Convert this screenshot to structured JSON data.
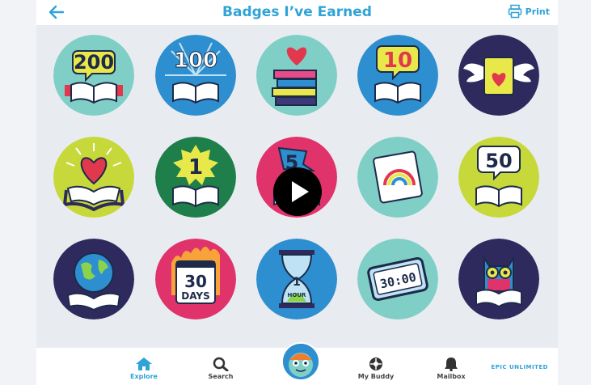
{
  "header": {
    "title": "Badges I’ve Earned",
    "print_label": "Print"
  },
  "badges": [
    {
      "text": "200"
    },
    {
      "text": "100"
    },
    {
      "text": ""
    },
    {
      "text": "10"
    },
    {
      "text": ""
    },
    {
      "text": ""
    },
    {
      "text": "1"
    },
    {
      "text": "5"
    },
    {
      "text": ""
    },
    {
      "text": "50"
    },
    {
      "text": ""
    },
    {
      "text_line1": "30",
      "text_line2": "DAYS"
    },
    {
      "text_line1": "1",
      "text_line2": "HOUR"
    },
    {
      "text": "30:00"
    },
    {
      "text": ""
    }
  ],
  "nav": {
    "explore": "Explore",
    "search": "Search",
    "my_buddy": "My Buddy",
    "mailbox": "Mailbox",
    "epic_unlimited": "EPIC UNLIMITED"
  },
  "colors": {
    "accent": "#2fa3d6"
  }
}
